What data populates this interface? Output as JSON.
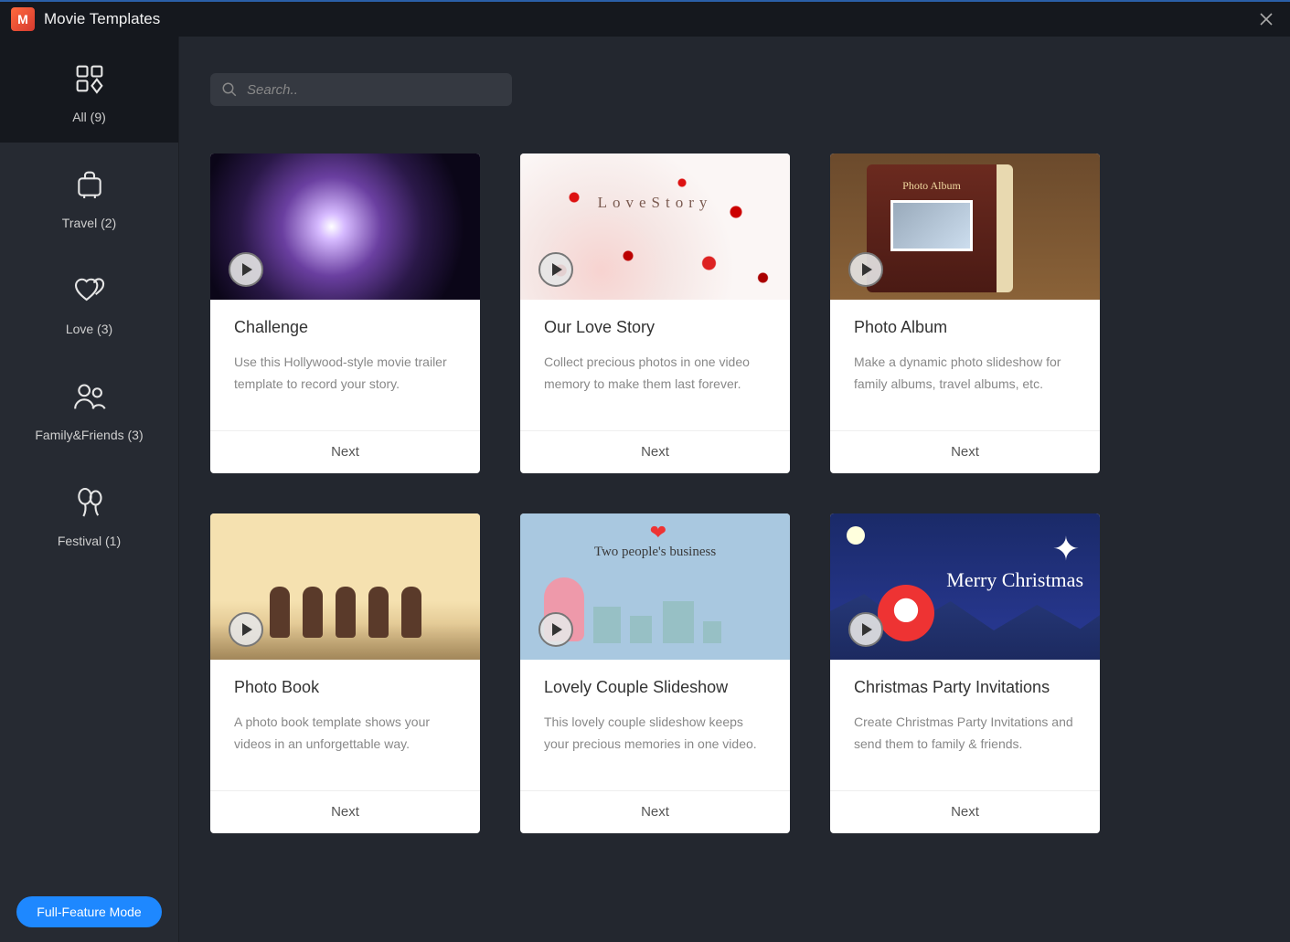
{
  "window": {
    "title": "Movie Templates"
  },
  "search": {
    "placeholder": "Search.."
  },
  "sidebar": {
    "items": [
      {
        "label": "All   (9)",
        "icon": "grid",
        "active": true
      },
      {
        "label": "Travel   (2)",
        "icon": "suitcase",
        "active": false
      },
      {
        "label": "Love   (3)",
        "icon": "hearts",
        "active": false
      },
      {
        "label": "Family&Friends   (3)",
        "icon": "people",
        "active": false
      },
      {
        "label": "Festival   (1)",
        "icon": "balloons",
        "active": false
      }
    ]
  },
  "full_feature_label": "Full-Feature Mode",
  "next_label": "Next",
  "overlays": {
    "lovestory_text": "LoveStory",
    "photoalbum_text": "Photo Album",
    "couple_text": "Two people's business",
    "xmas_text": "Merry Christmas"
  },
  "templates": [
    {
      "title": "Challenge",
      "desc": "Use this Hollywood-style movie trailer template to record your story.",
      "thumb": "challenge"
    },
    {
      "title": "Our Love Story",
      "desc": "Collect precious photos in one video memory to make them last forever.",
      "thumb": "lovestory"
    },
    {
      "title": "Photo Album",
      "desc": "Make a dynamic photo slideshow for family albums, travel albums, etc.",
      "thumb": "photoalbum"
    },
    {
      "title": "Photo Book",
      "desc": "A photo book template shows your videos in an unforgettable way.",
      "thumb": "photobook"
    },
    {
      "title": "Lovely Couple Slideshow",
      "desc": "This lovely couple slideshow keeps your precious memories in one video.",
      "thumb": "couple"
    },
    {
      "title": "Christmas Party Invitations",
      "desc": "Create Christmas Party Invitations and send them to family & friends.",
      "thumb": "xmas"
    }
  ]
}
